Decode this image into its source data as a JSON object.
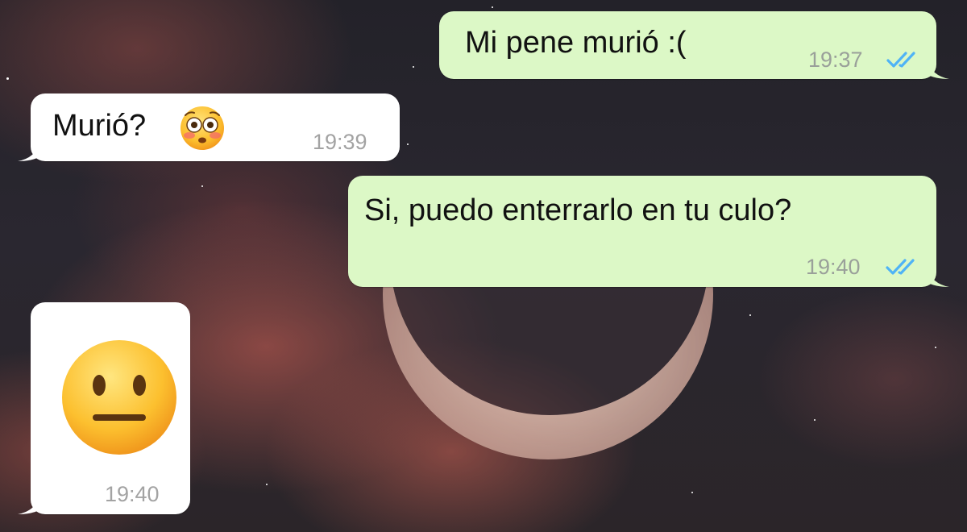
{
  "conversation": {
    "messages": [
      {
        "direction": "outgoing",
        "text": "Mi pene murió :(",
        "time": "19:37",
        "status": "read",
        "status_icon": "double-check-icon"
      },
      {
        "direction": "incoming",
        "text": "Murió?",
        "emoji": "flushed-face-emoji",
        "time": "19:39"
      },
      {
        "direction": "outgoing",
        "text": "Si, puedo enterrarlo en tu culo?",
        "time": "19:40",
        "status": "read",
        "status_icon": "double-check-icon"
      },
      {
        "direction": "incoming",
        "emoji": "neutral-face-emoji",
        "time": "19:40"
      }
    ]
  },
  "colors": {
    "outgoing_bubble": "#dcf8c6",
    "incoming_bubble": "#ffffff",
    "read_ticks": "#4fb3f6",
    "time_text": "#9aa09a"
  }
}
